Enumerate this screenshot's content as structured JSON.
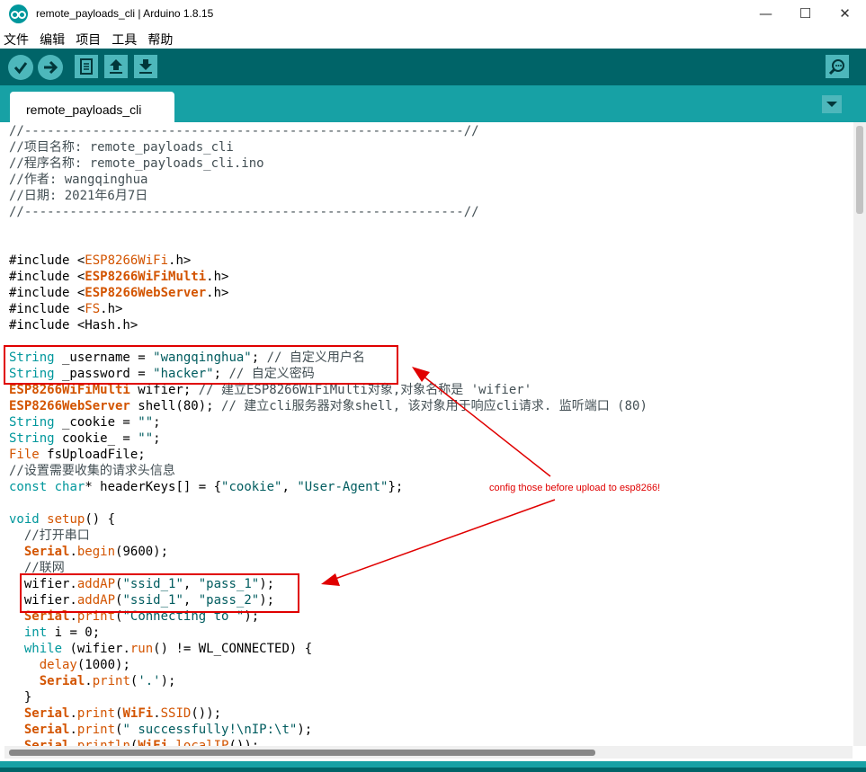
{
  "window": {
    "title": "remote_payloads_cli | Arduino 1.8.15",
    "controls": {
      "minimize": "—",
      "maximize": "☐",
      "close": "✕"
    }
  },
  "menu": [
    "文件",
    "编辑",
    "项目",
    "工具",
    "帮助"
  ],
  "toolbar": {
    "verify": "verify-icon",
    "upload": "upload-icon",
    "new": "new-icon",
    "open": "open-icon",
    "save": "save-icon",
    "serial_monitor": "serial-monitor-icon"
  },
  "tab": {
    "label": "remote_payloads_cli"
  },
  "code": [
    [
      [
        "c",
        "//----------------------------------------------------------//"
      ]
    ],
    [
      [
        "c",
        "//项目名称: remote_payloads_cli"
      ]
    ],
    [
      [
        "c",
        "//程序名称: remote_payloads_cli.ino"
      ]
    ],
    [
      [
        "c",
        "//作者: wangqinghua"
      ]
    ],
    [
      [
        "c",
        "//日期: 2021年6月7日"
      ]
    ],
    [
      [
        "c",
        "//----------------------------------------------------------//"
      ]
    ],
    [],
    [],
    [
      [
        "",
        "#include <"
      ],
      [
        "o",
        "ESP8266WiFi"
      ],
      [
        "",
        ".h>"
      ]
    ],
    [
      [
        "",
        "#include <"
      ],
      [
        "ob",
        "ESP8266WiFiMulti"
      ],
      [
        "",
        ".h>"
      ]
    ],
    [
      [
        "",
        "#include <"
      ],
      [
        "ob",
        "ESP8266WebServer"
      ],
      [
        "",
        ".h>"
      ]
    ],
    [
      [
        "",
        "#include <"
      ],
      [
        "o",
        "FS"
      ],
      [
        "",
        ".h>"
      ]
    ],
    [
      [
        "",
        "#include <Hash.h>"
      ]
    ],
    [],
    [
      [
        "k",
        "String"
      ],
      [
        "",
        " _username = "
      ],
      [
        "s",
        "\"wangqinghua\""
      ],
      [
        "",
        "; "
      ],
      [
        "c",
        "// 自定义用户名"
      ]
    ],
    [
      [
        "k",
        "String"
      ],
      [
        "",
        " _password = "
      ],
      [
        "s",
        "\"hacker\""
      ],
      [
        "",
        "; "
      ],
      [
        "c",
        "// 自定义密码"
      ]
    ],
    [
      [
        "ob",
        "ESP8266WiFiMulti"
      ],
      [
        "",
        " wifier; "
      ],
      [
        "c",
        "// 建立ESP8266WiFiMulti对象,对象名称是 'wifier'"
      ]
    ],
    [
      [
        "ob",
        "ESP8266WebServer"
      ],
      [
        "",
        " shell(80); "
      ],
      [
        "c",
        "// 建立cli服务器对象shell, 该对象用于响应cli请求. 监听端口 (80)"
      ]
    ],
    [
      [
        "k",
        "String"
      ],
      [
        "",
        " _cookie = "
      ],
      [
        "s",
        "\"\""
      ],
      [
        "",
        ";"
      ]
    ],
    [
      [
        "k",
        "String"
      ],
      [
        "",
        " cookie_ = "
      ],
      [
        "s",
        "\"\""
      ],
      [
        "",
        ";"
      ]
    ],
    [
      [
        "o",
        "File"
      ],
      [
        "",
        " fsUploadFile;"
      ]
    ],
    [
      [
        "c",
        "//设置需要收集的请求头信息"
      ]
    ],
    [
      [
        "k",
        "const"
      ],
      [
        "",
        " "
      ],
      [
        "k",
        "char"
      ],
      [
        "",
        "* headerKeys[] = {"
      ],
      [
        "s",
        "\"cookie\""
      ],
      [
        "",
        ", "
      ],
      [
        "s",
        "\"User-Agent\""
      ],
      [
        "",
        "};"
      ]
    ],
    [],
    [
      [
        "k",
        "void"
      ],
      [
        "",
        " "
      ],
      [
        "o",
        "setup"
      ],
      [
        "",
        "() {"
      ]
    ],
    [
      [
        "",
        "  "
      ],
      [
        "c",
        "//打开串口"
      ]
    ],
    [
      [
        "",
        "  "
      ],
      [
        "ob",
        "Serial"
      ],
      [
        "",
        "."
      ],
      [
        "o",
        "begin"
      ],
      [
        "",
        "(9600);"
      ]
    ],
    [
      [
        "",
        "  "
      ],
      [
        "c",
        "//联网"
      ]
    ],
    [
      [
        "",
        "  wifier."
      ],
      [
        "o",
        "addAP"
      ],
      [
        "",
        "("
      ],
      [
        "s",
        "\"ssid_1\""
      ],
      [
        "",
        ", "
      ],
      [
        "s",
        "\"pass_1\""
      ],
      [
        "",
        ");"
      ]
    ],
    [
      [
        "",
        "  wifier."
      ],
      [
        "o",
        "addAP"
      ],
      [
        "",
        "("
      ],
      [
        "s",
        "\"ssid_1\""
      ],
      [
        "",
        ", "
      ],
      [
        "s",
        "\"pass_2\""
      ],
      [
        "",
        ");"
      ]
    ],
    [
      [
        "",
        "  "
      ],
      [
        "ob",
        "Serial"
      ],
      [
        "",
        "."
      ],
      [
        "o",
        "print"
      ],
      [
        "",
        "("
      ],
      [
        "s",
        "\"Connecting to \""
      ],
      [
        "",
        ");"
      ]
    ],
    [
      [
        "",
        "  "
      ],
      [
        "k",
        "int"
      ],
      [
        "",
        " i = 0;"
      ]
    ],
    [
      [
        "",
        "  "
      ],
      [
        "k",
        "while"
      ],
      [
        "",
        " (wifier."
      ],
      [
        "o",
        "run"
      ],
      [
        "",
        "() != WL_CONNECTED) {"
      ]
    ],
    [
      [
        "",
        "    "
      ],
      [
        "o",
        "delay"
      ],
      [
        "",
        "(1000);"
      ]
    ],
    [
      [
        "",
        "    "
      ],
      [
        "ob",
        "Serial"
      ],
      [
        "",
        "."
      ],
      [
        "o",
        "print"
      ],
      [
        "",
        "("
      ],
      [
        "s",
        "'.'"
      ],
      [
        "",
        ");"
      ]
    ],
    [
      [
        "",
        "  }"
      ]
    ],
    [
      [
        "",
        "  "
      ],
      [
        "ob",
        "Serial"
      ],
      [
        "",
        "."
      ],
      [
        "o",
        "print"
      ],
      [
        "",
        "("
      ],
      [
        "ob",
        "WiFi"
      ],
      [
        "",
        "."
      ],
      [
        "o",
        "SSID"
      ],
      [
        "",
        "());"
      ]
    ],
    [
      [
        "",
        "  "
      ],
      [
        "ob",
        "Serial"
      ],
      [
        "",
        "."
      ],
      [
        "o",
        "print"
      ],
      [
        "",
        "("
      ],
      [
        "s",
        "\" successfully!\\nIP:\\t\""
      ],
      [
        "",
        ");"
      ]
    ],
    [
      [
        "",
        "  "
      ],
      [
        "ob",
        "Serial"
      ],
      [
        "",
        "."
      ],
      [
        "o",
        "println"
      ],
      [
        "",
        "("
      ],
      [
        "ob",
        "WiFi"
      ],
      [
        "",
        "."
      ],
      [
        "o",
        "localIP"
      ],
      [
        "",
        "());"
      ]
    ]
  ],
  "annotation": {
    "text": "config those before upload to esp8266!",
    "color": "#e00000"
  },
  "colors": {
    "toolbar": "#006468",
    "tabstrip": "#17a1a5",
    "button": "#4db7bb",
    "comment": "#434f54",
    "keyword": "#00979c",
    "function": "#d35400",
    "string": "#005c5f"
  }
}
